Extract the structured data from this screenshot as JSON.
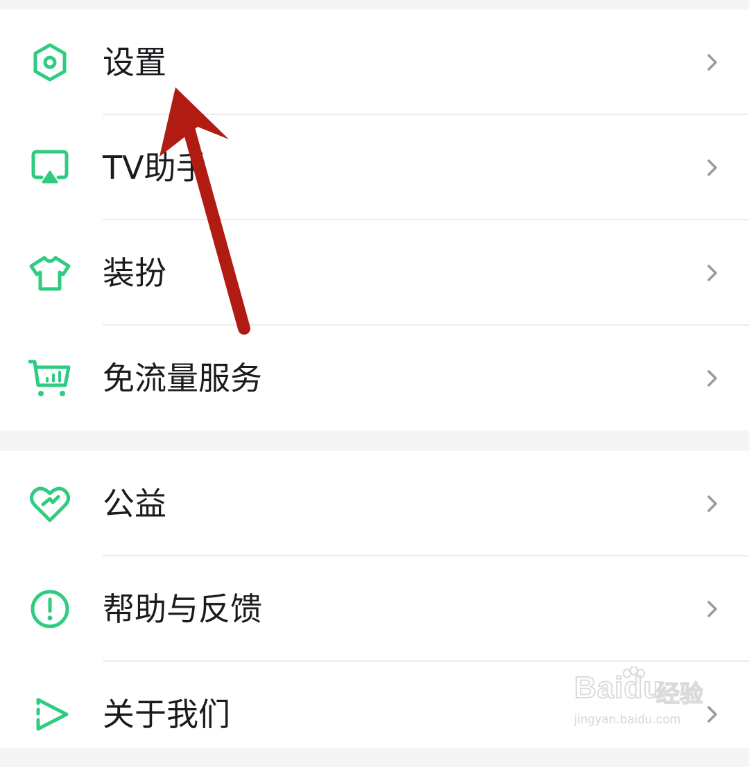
{
  "colors": {
    "accent": "#2ecc80",
    "text": "#1b1b1f",
    "chevron": "#9a9a9a",
    "annotation_arrow": "#b01c12"
  },
  "menu_groups": [
    {
      "items": [
        {
          "label": "设置",
          "icon": "settings-hexagon-icon"
        },
        {
          "label": "TV助手",
          "icon": "tv-cast-icon"
        },
        {
          "label": "装扮",
          "icon": "tshirt-icon"
        },
        {
          "label": "免流量服务",
          "icon": "shopping-cart-icon"
        }
      ]
    },
    {
      "items": [
        {
          "label": "公益",
          "icon": "charity-heart-icon"
        },
        {
          "label": "帮助与反馈",
          "icon": "exclamation-circle-icon"
        },
        {
          "label": "关于我们",
          "icon": "play-triangle-icon"
        }
      ]
    }
  ],
  "watermark": {
    "brand": "Bai",
    "brand2": "du",
    "cn": "经验",
    "url": "jingyan.baidu.com"
  }
}
